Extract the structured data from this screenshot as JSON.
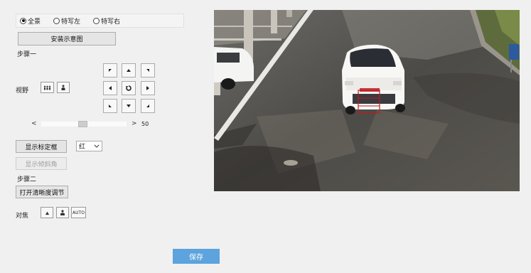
{
  "view_mode": {
    "options": [
      {
        "label": "全景",
        "checked": true
      },
      {
        "label": "特写左",
        "checked": false
      },
      {
        "label": "特写右",
        "checked": false
      }
    ]
  },
  "install_diagram_label": "安装示意图",
  "step1_label": "步骤一",
  "view_label": "视野",
  "slider": {
    "value": "50",
    "left_arrow": "<",
    "right_arrow": ">"
  },
  "show_calib_label": "显示标定框",
  "color_select": {
    "value": "红"
  },
  "show_tilt_label": "显示倾斜角",
  "step2_label": "步骤二",
  "open_clarity_label": "打开清晰度调节",
  "focus_label": "对焦",
  "focus_auto_label": "AUTO",
  "save_label": "保存",
  "colors": {
    "save_button": "#5da3dd",
    "calib_box": "#c0191f"
  }
}
